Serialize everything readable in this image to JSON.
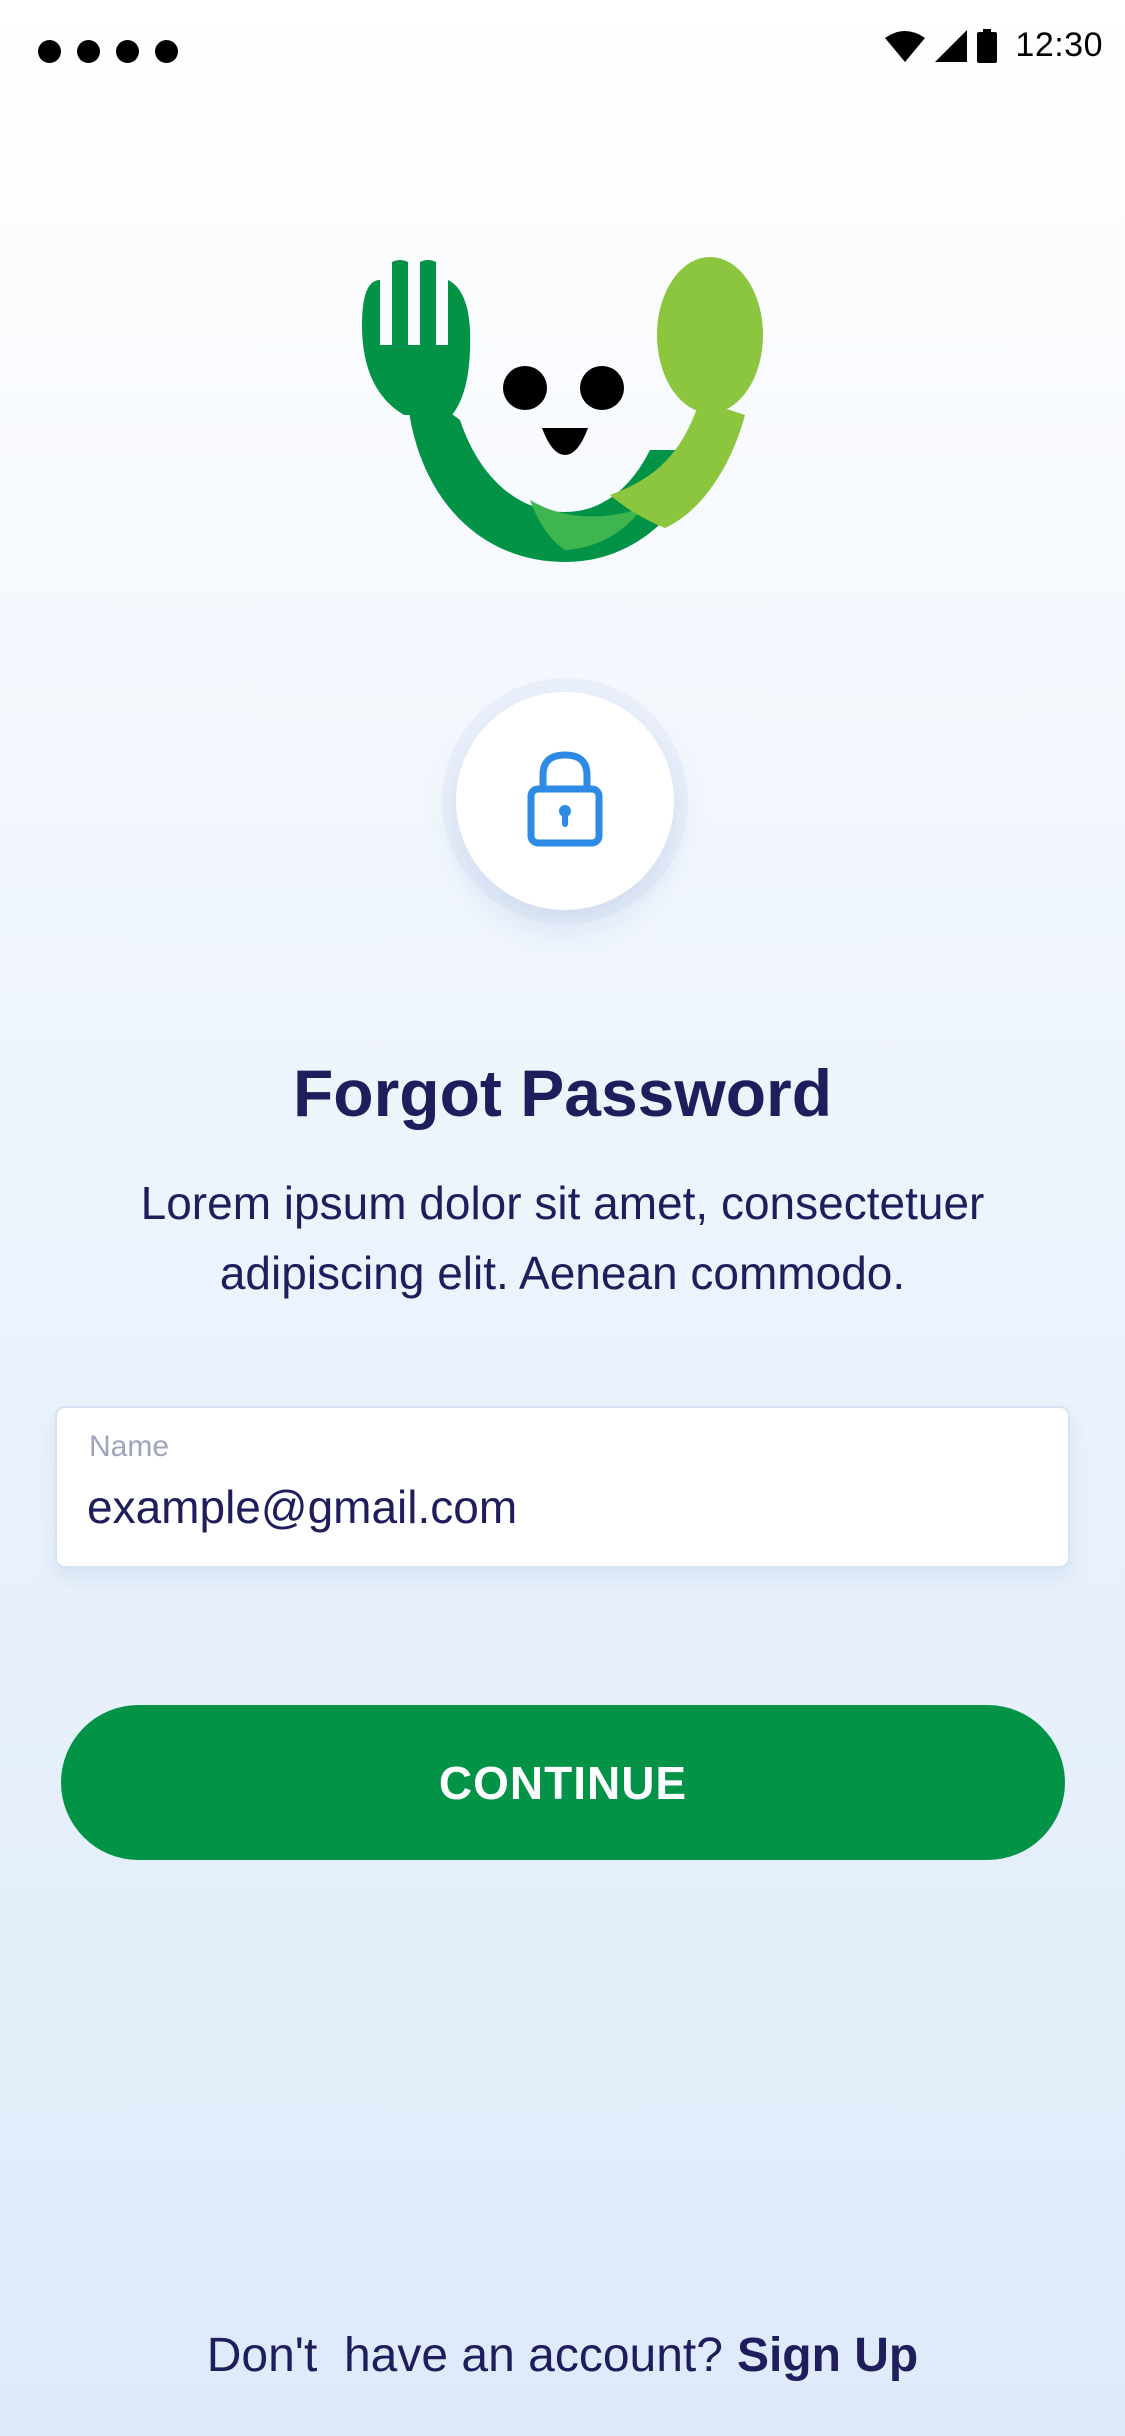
{
  "status_bar": {
    "time": "12:30",
    "icons": [
      "signal-dots-icon",
      "wifi-icon",
      "cellular-icon",
      "battery-icon"
    ]
  },
  "logo": {
    "icon": "fork-spoon-smiley-logo",
    "colors": {
      "dark_green": "#029347",
      "mid_green": "#3fb550",
      "light_green": "#8cc63f"
    }
  },
  "lock": {
    "icon": "lock-icon",
    "color": "#2d8ae5"
  },
  "title": "Forgot Password",
  "subtitle": "Lorem ipsum dolor sit amet, consectetuer adipiscing elit. Aenean commodo.",
  "form": {
    "field_label": "Name",
    "field_value": "example@gmail.com"
  },
  "continue_button": {
    "label": "CONTINUE",
    "color": "#029347"
  },
  "footer": {
    "prompt": "Don't  have an account?",
    "link": "Sign Up"
  },
  "colors": {
    "text_primary": "#1f1d5c",
    "label_gray": "#a0a3bd"
  }
}
